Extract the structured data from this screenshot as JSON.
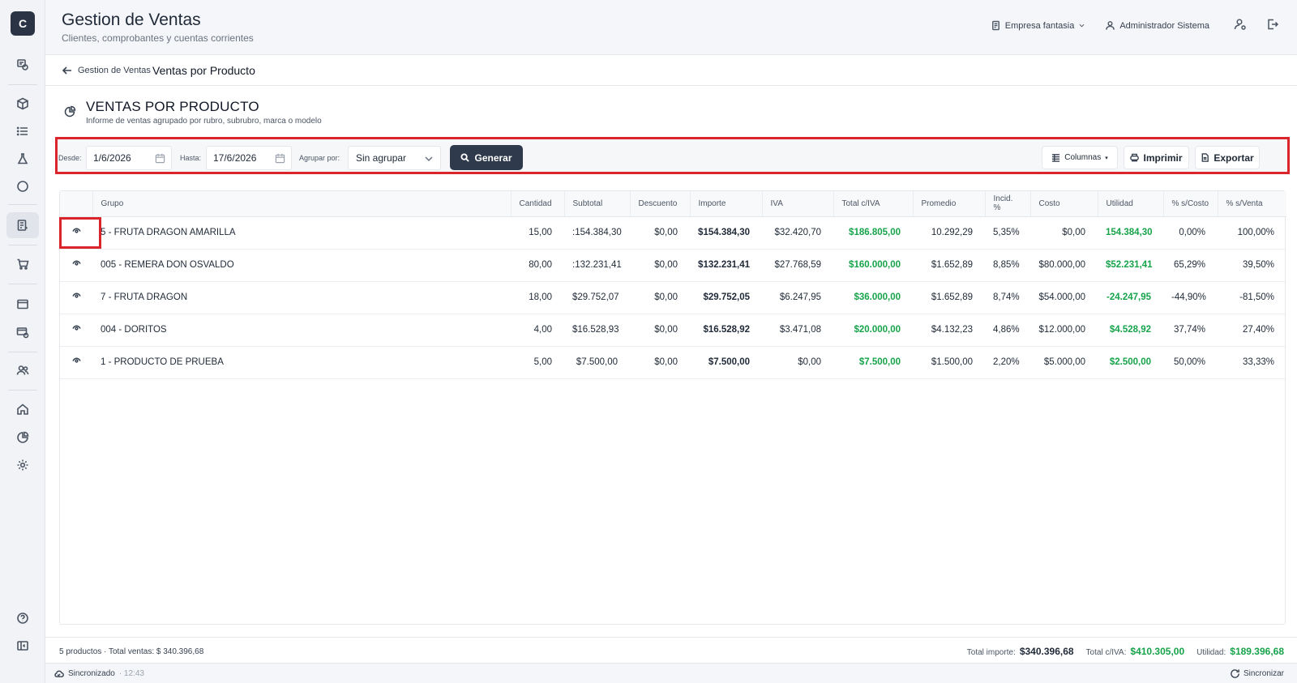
{
  "app": {
    "logo_letter": "C",
    "title": "Gestion de Ventas",
    "subtitle": "Clientes, comprobantes y cuentas corrientes"
  },
  "header": {
    "company": "Empresa fantasia",
    "user": "Administrador Sistema"
  },
  "breadcrumb": {
    "back_label": "Gestion de Ventas",
    "current": "Ventas por Producto"
  },
  "page": {
    "title": "VENTAS POR PRODUCTO",
    "subtitle": "Informe de ventas agrupado por rubro, subrubro, marca o modelo"
  },
  "filters": {
    "desde_label": "Desde:",
    "desde_value": "1/6/2026",
    "hasta_label": "Hasta:",
    "hasta_value": "17/6/2026",
    "agrupar_label": "Agrupar por:",
    "agrupar_value": "Sin agrupar",
    "generate_label": "Generar",
    "columns_label": "Columnas",
    "print_label": "Imprimir",
    "export_label": "Exportar"
  },
  "table": {
    "headers": [
      "Grupo",
      "Cantidad",
      "Subtotal",
      "Descuento",
      "Importe",
      "IVA",
      "Total c/IVA",
      "Promedio",
      "Incid. %",
      "Costo",
      "Utilidad",
      "% s/Costo",
      "% s/Venta"
    ],
    "rows": [
      {
        "grupo": "5 - FRUTA DRAGON AMARILLA",
        "cantidad": "15,00",
        "subtotal": ":154.384,30",
        "descuento": "$0,00",
        "importe": "$154.384,30",
        "iva": "$32.420,70",
        "total": "$186.805,00",
        "promedio": "10.292,29",
        "incid": "5,35%",
        "costo": "$0,00",
        "utilidad": "154.384,30",
        "s_costo": "0,00%",
        "s_venta": "100,00%"
      },
      {
        "grupo": "005 - REMERA DON OSVALDO",
        "cantidad": "80,00",
        "subtotal": ":132.231,41",
        "descuento": "$0,00",
        "importe": "$132.231,41",
        "iva": "$27.768,59",
        "total": "$160.000,00",
        "promedio": "$1.652,89",
        "incid": "8,85%",
        "costo": "$80.000,00",
        "utilidad": "$52.231,41",
        "s_costo": "65,29%",
        "s_venta": "39,50%"
      },
      {
        "grupo": "7 - FRUTA DRAGON",
        "cantidad": "18,00",
        "subtotal": "$29.752,07",
        "descuento": "$0,00",
        "importe": "$29.752,05",
        "iva": "$6.247,95",
        "total": "$36.000,00",
        "promedio": "$1.652,89",
        "incid": "8,74%",
        "costo": "$54.000,00",
        "utilidad": "-24.247,95",
        "s_costo": "-44,90%",
        "s_venta": "-81,50%"
      },
      {
        "grupo": "004 - DORITOS",
        "cantidad": "4,00",
        "subtotal": "$16.528,93",
        "descuento": "$0,00",
        "importe": "$16.528,92",
        "iva": "$3.471,08",
        "total": "$20.000,00",
        "promedio": "$4.132,23",
        "incid": "4,86%",
        "costo": "$12.000,00",
        "utilidad": "$4.528,92",
        "s_costo": "37,74%",
        "s_venta": "27,40%"
      },
      {
        "grupo": "1 - PRODUCTO DE PRUEBA",
        "cantidad": "5,00",
        "subtotal": "$7.500,00",
        "descuento": "$0,00",
        "importe": "$7.500,00",
        "iva": "$0,00",
        "total": "$7.500,00",
        "promedio": "$1.500,00",
        "incid": "2,20%",
        "costo": "$5.000,00",
        "utilidad": "$2.500,00",
        "s_costo": "50,00%",
        "s_venta": "33,33%"
      }
    ]
  },
  "footer": {
    "summary": "5 productos · Total ventas: $ 340.396,68",
    "total_importe_label": "Total importe:",
    "total_importe": "$340.396,68",
    "total_iva_label": "Total c/IVA:",
    "total_iva": "$410.305,00",
    "utilidad_label": "Utilidad:",
    "utilidad": "$189.396,68"
  },
  "status": {
    "sync_label": "Sincronizado",
    "sync_time": "· 12:43",
    "sync_button": "Sincronizar"
  }
}
